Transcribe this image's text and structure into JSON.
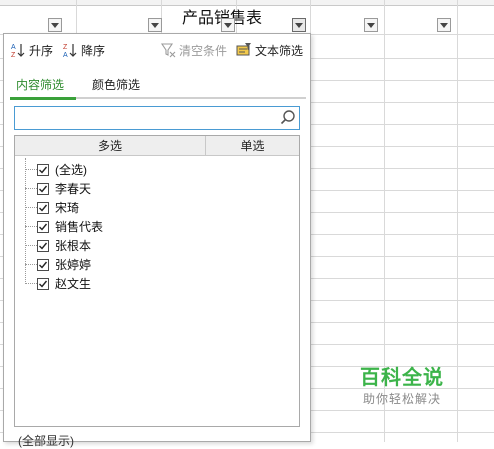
{
  "sheet": {
    "title": "产品销售表"
  },
  "toolbar": {
    "asc_label": "升序",
    "desc_label": "降序",
    "clear_label": "清空条件",
    "text_filter_label": "文本筛选"
  },
  "tabs": [
    {
      "label": "内容筛选",
      "active": true
    },
    {
      "label": "颜色筛选",
      "active": false
    }
  ],
  "search": {
    "value": "",
    "placeholder": ""
  },
  "list": {
    "columns": [
      "多选",
      "单选"
    ],
    "items": [
      {
        "label": "(全选)",
        "checked": true
      },
      {
        "label": "李春天",
        "checked": true
      },
      {
        "label": "宋琦",
        "checked": true
      },
      {
        "label": "销售代表",
        "checked": true
      },
      {
        "label": "张根本",
        "checked": true
      },
      {
        "label": "张婷婷",
        "checked": true
      },
      {
        "label": "赵文生",
        "checked": true
      }
    ]
  },
  "footer": {
    "partial_text": "(全部显示)"
  },
  "watermark": {
    "logo": "百科全说",
    "tagline": "助你轻松解决"
  },
  "colors": {
    "accent_green": "#3aa13a",
    "search_border": "#4a9bd3",
    "watermark_green": "#3cb44a"
  }
}
